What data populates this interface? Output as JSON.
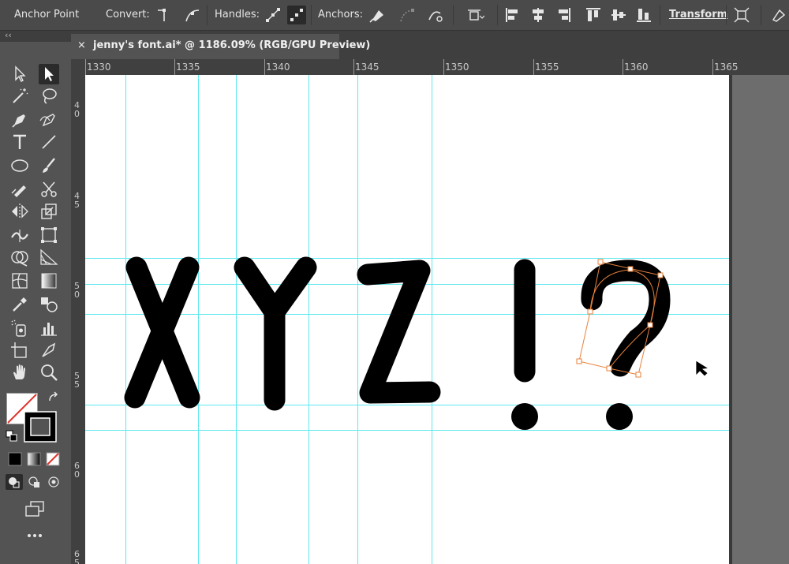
{
  "control_bar": {
    "tool_name": "Anchor Point",
    "convert_label": "Convert:",
    "handles_label": "Handles:",
    "anchors_label": "Anchors:",
    "transform_label": "Transform"
  },
  "collapse_label": "‹‹",
  "document_tab": {
    "close_glyph": "×",
    "title": "jenny's font.ai* @ 1186.09% (RGB/GPU Preview)"
  },
  "ruler_top": [
    "1330",
    "1335",
    "1340",
    "1345",
    "1350",
    "1355",
    "1360",
    "1365"
  ],
  "ruler_left": [
    "40",
    "45",
    "50",
    "55",
    "60",
    "65"
  ],
  "artwork": {
    "glyphs": [
      "X",
      "Y",
      "Z",
      "!",
      "?"
    ],
    "fill_color": "#000000",
    "selection_color": "#e8813a",
    "guide_color": "#5ee8ee"
  },
  "tools": [
    "selection-tool",
    "direct-selection-tool",
    "magic-wand-tool",
    "lasso-tool",
    "pen-tool",
    "curvature-tool",
    "type-tool",
    "line-segment-tool",
    "ellipse-tool",
    "paintbrush-tool",
    "shaper-tool",
    "scissors-tool",
    "rotate-tool",
    "scale-tool",
    "width-tool",
    "free-transform-tool",
    "shape-builder-tool",
    "perspective-grid-tool",
    "mesh-tool",
    "gradient-tool",
    "eyedropper-tool",
    "blend-tool",
    "symbol-sprayer-tool",
    "column-graph-tool",
    "artboard-tool",
    "slice-tool",
    "hand-tool",
    "zoom-tool"
  ]
}
